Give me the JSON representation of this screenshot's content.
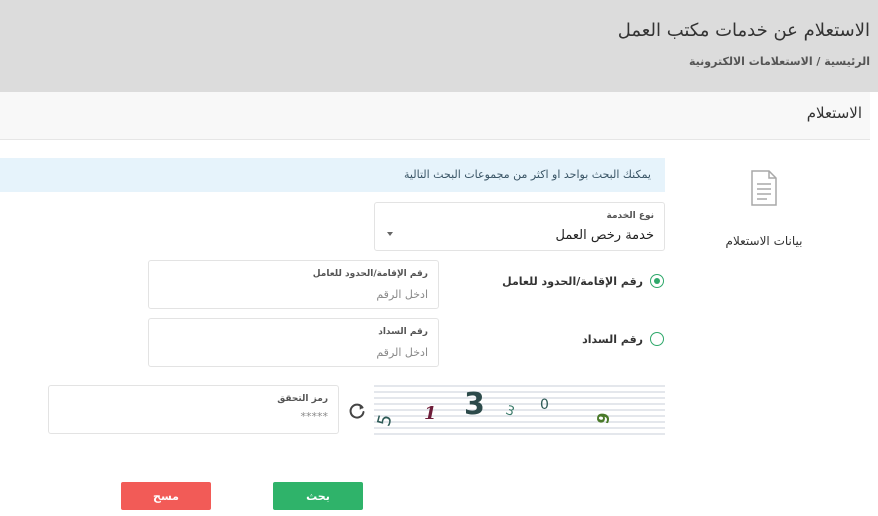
{
  "header": {
    "title": "الاستعلام عن خدمات مكتب العمل",
    "breadcrumb": "الرئيسية / الاستعلامات الالكترونية"
  },
  "section": {
    "title": "الاستعلام"
  },
  "sidebar": {
    "card_label": "بيانات الاستعلام",
    "icon": "document-icon"
  },
  "info": {
    "text": "يمكنك البحث بواحد او اكثر من مجموعات البحث التالية"
  },
  "service_type": {
    "label": "نوع الخدمة",
    "selected": "خدمة رخص العمل"
  },
  "options": {
    "iqama": {
      "label": "رقم الإقامة/الحدود للعامل",
      "checked": true
    },
    "payment": {
      "label": "رقم السداد",
      "checked": false
    }
  },
  "fields": {
    "iqama": {
      "label": "رقم الإقامة/الحدود للعامل",
      "placeholder": "ادخل الرقم"
    },
    "payment": {
      "label": "رقم السداد",
      "placeholder": "ادخل الرقم"
    },
    "verification": {
      "label": "رمز التحقق",
      "placeholder": "*****"
    }
  },
  "captcha": {
    "glyphs": [
      {
        "char": "5",
        "color": "#2d5a56"
      },
      {
        "char": "1",
        "color": "#6e1e3a"
      },
      {
        "char": "3",
        "color": "#2c4a4a"
      },
      {
        "char": "3",
        "color": "#3a7a6a"
      },
      {
        "char": "0",
        "color": "#2d5a56"
      },
      {
        "char": "9",
        "color": "#4a7a2a"
      }
    ]
  },
  "buttons": {
    "search": "بحث",
    "clear": "مسح"
  },
  "colors": {
    "accent_green": "#2fb36a",
    "danger_red": "#f25b57",
    "info_bg": "#e6f3fb",
    "header_bg": "#dcdcdc"
  }
}
